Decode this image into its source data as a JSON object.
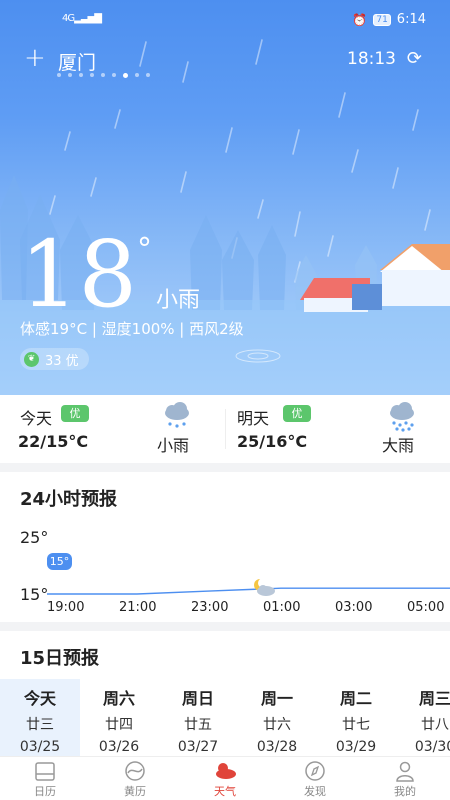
{
  "status_bar": {
    "signal": "4G",
    "battery": "71",
    "time": "6:14"
  },
  "header": {
    "add_label": "+",
    "city": "厦门",
    "update_time": "18:13",
    "refresh_icon": "refresh-icon"
  },
  "current": {
    "temperature": "18",
    "degree_symbol": "°",
    "condition": "小雨",
    "details": "体感19°C | 湿度100% | 西风2级",
    "aqi": "33 优"
  },
  "today": {
    "label": "今天",
    "aqi_badge": "优",
    "range": "22/15°C",
    "condition": "小雨",
    "icon": "light-rain-icon"
  },
  "tomorrow": {
    "label": "明天",
    "aqi_badge": "优",
    "range": "25/16°C",
    "condition": "大雨",
    "icon": "heavy-rain-icon"
  },
  "hourly": {
    "title": "24小时预报",
    "y_high": "25°",
    "y_low": "15°",
    "current_temp": "15°",
    "hours": [
      "19:00",
      "21:00",
      "23:00",
      "01:00",
      "03:00",
      "05:00"
    ]
  },
  "chart_data": {
    "type": "line",
    "title": "24小时预报",
    "x": [
      "19:00",
      "21:00",
      "23:00",
      "01:00",
      "03:00",
      "05:00"
    ],
    "y": [
      15,
      15,
      15.5,
      16,
      16,
      16
    ],
    "ylim": [
      15,
      25
    ],
    "ytick_labels": [
      "25°",
      "15°"
    ],
    "annotations": [
      {
        "x": "19:00",
        "label": "15°"
      }
    ],
    "icons": [
      {
        "x": "01:00",
        "icon": "partly-cloudy-night-icon"
      }
    ],
    "grid": false
  },
  "daily": {
    "title": "15日预报",
    "days": [
      {
        "name": "今天",
        "lunar": "廿三",
        "date": "03/25"
      },
      {
        "name": "周六",
        "lunar": "廿四",
        "date": "03/26"
      },
      {
        "name": "周日",
        "lunar": "廿五",
        "date": "03/27"
      },
      {
        "name": "周一",
        "lunar": "廿六",
        "date": "03/28"
      },
      {
        "name": "周二",
        "lunar": "廿七",
        "date": "03/29"
      },
      {
        "name": "周三",
        "lunar": "廿八",
        "date": "03/30"
      }
    ]
  },
  "nav": {
    "items": [
      {
        "label": "日历",
        "icon": "calendar-icon"
      },
      {
        "label": "黄历",
        "icon": "almanac-icon"
      },
      {
        "label": "天气",
        "icon": "weather-icon",
        "active": true
      },
      {
        "label": "发现",
        "icon": "compass-icon"
      },
      {
        "label": "我的",
        "icon": "profile-icon"
      }
    ]
  },
  "colors": {
    "hero": "#4d8ff0",
    "accent_green": "#5cc66c",
    "active_nav": "#e0443a",
    "line": "#4d8ff0"
  }
}
